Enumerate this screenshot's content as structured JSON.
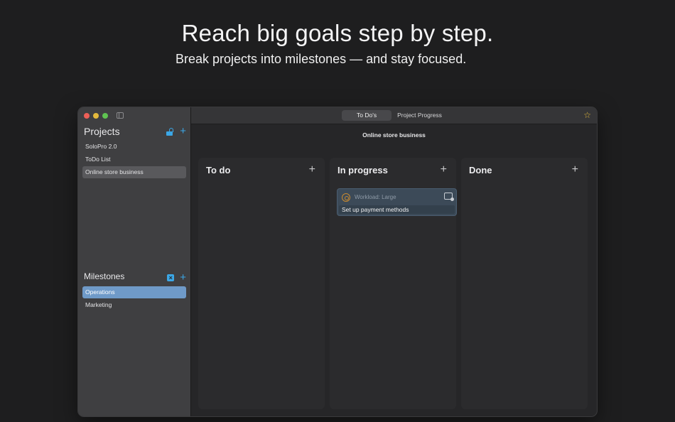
{
  "hero": {
    "title": "Reach big goals step by step.",
    "subtitle": "Break projects into milestones — and stay focused."
  },
  "sidebar": {
    "projects_title": "Projects",
    "projects": [
      {
        "label": "SoloPro 2.0"
      },
      {
        "label": "ToDo List"
      },
      {
        "label": "Online store business"
      }
    ],
    "selected_project": "Online store business",
    "milestones_title": "Milestones",
    "milestones": [
      {
        "label": "Operations"
      },
      {
        "label": "Marketing"
      }
    ],
    "selected_milestone": "Operations"
  },
  "toolbar": {
    "tabs": [
      {
        "label": "To Do's"
      },
      {
        "label": "Project Progress"
      }
    ],
    "active_tab": "To Do's"
  },
  "board": {
    "title": "Online store business",
    "columns": [
      {
        "title": "To do",
        "cards": []
      },
      {
        "title": "In progress",
        "cards": [
          {
            "workload": "Workload: Large",
            "text": "Set up payment methods"
          }
        ]
      },
      {
        "title": "Done",
        "cards": []
      }
    ]
  },
  "colors": {
    "accent": "#3ba7e6",
    "selection_blue": "#6f9ac8",
    "star": "#e3b93c",
    "background": "#1e1e1f"
  },
  "icons": [
    "close-window",
    "minimize-window",
    "zoom-window",
    "sidebar-toggle-icon",
    "lock-icon",
    "plus-icon",
    "clear-icon",
    "star-icon",
    "target-icon",
    "calendar-icon"
  ]
}
